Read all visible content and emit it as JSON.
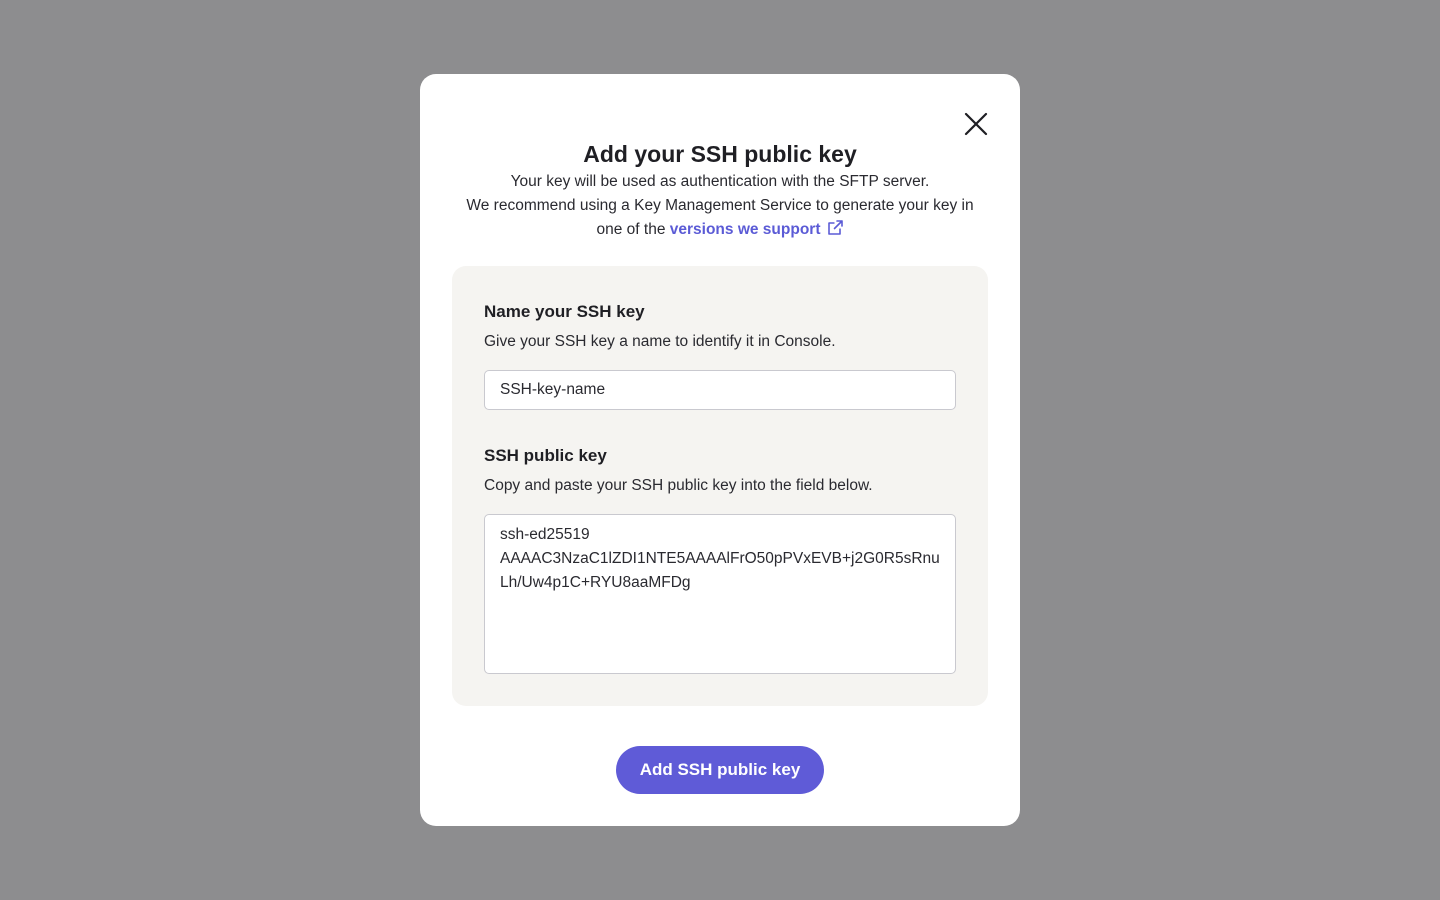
{
  "modal": {
    "title": "Add your SSH public key",
    "description_line1": "Your key will be used as authentication with the SFTP server.",
    "description_line2": "We recommend using a Key Management Service to generate your key in",
    "description_line3_prefix": "one of the",
    "link_text": "versions we support",
    "link_icon": "external-link-icon",
    "close_icon": "close-icon"
  },
  "name_field": {
    "label": "Name your SSH key",
    "help": "Give your SSH key a name to identify it in Console.",
    "value": "SSH-key-name",
    "placeholder": ""
  },
  "key_field": {
    "label": "SSH public key",
    "help": "Copy and paste your SSH public key into the field below.",
    "value": "ssh-ed25519\nAAAAC3NzaC1lZDI1NTE5AAAAlFrO50pPVxEVB+j2G0R5sRnuLh/Uw4p1C+RYU8aaMFDg"
  },
  "actions": {
    "submit_label": "Add SSH public key"
  },
  "colors": {
    "backdrop": "#8d8d8f",
    "accent": "#5f5bd7",
    "link": "#5b5bd6",
    "panel": "#f5f4f1"
  }
}
